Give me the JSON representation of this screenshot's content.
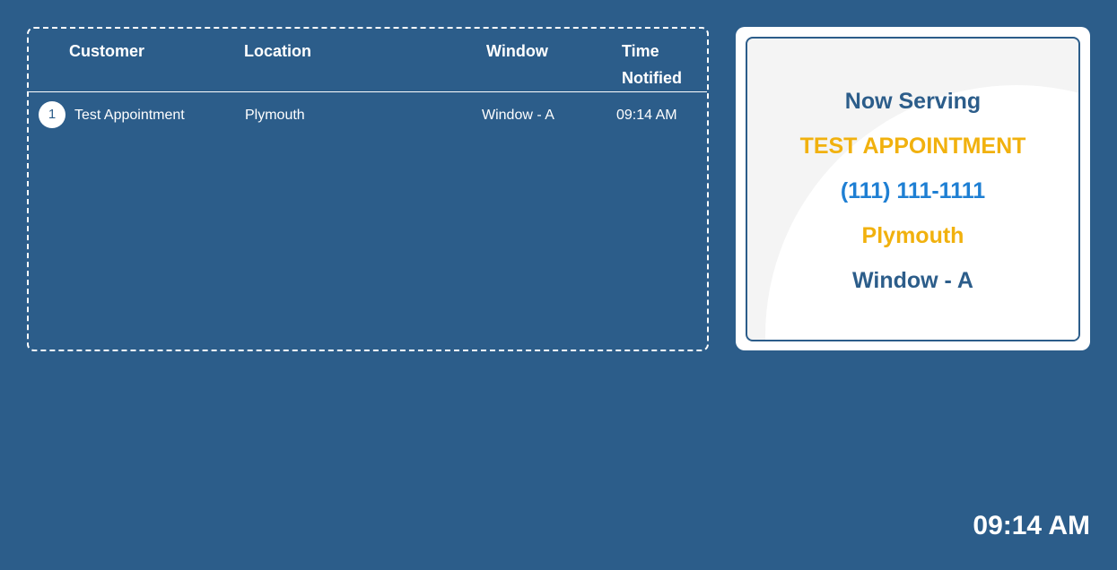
{
  "queue": {
    "columns": {
      "customer": "Customer",
      "location": "Location",
      "window": "Window",
      "time_notified": "Time Notified"
    },
    "rows": [
      {
        "number": "1",
        "customer": "Test Appointment",
        "location": "Plymouth",
        "window": "Window - A",
        "time": "09:14 AM"
      }
    ]
  },
  "now_serving": {
    "heading": "Now Serving",
    "name": "TEST APPOINTMENT",
    "phone": "(111) 111-1111",
    "location": "Plymouth",
    "window": "Window - A"
  },
  "clock": "09:14 AM",
  "colors": {
    "background": "#2c5d8a",
    "accent_yellow": "#f1b10e",
    "accent_blue": "#1e7fd3"
  }
}
